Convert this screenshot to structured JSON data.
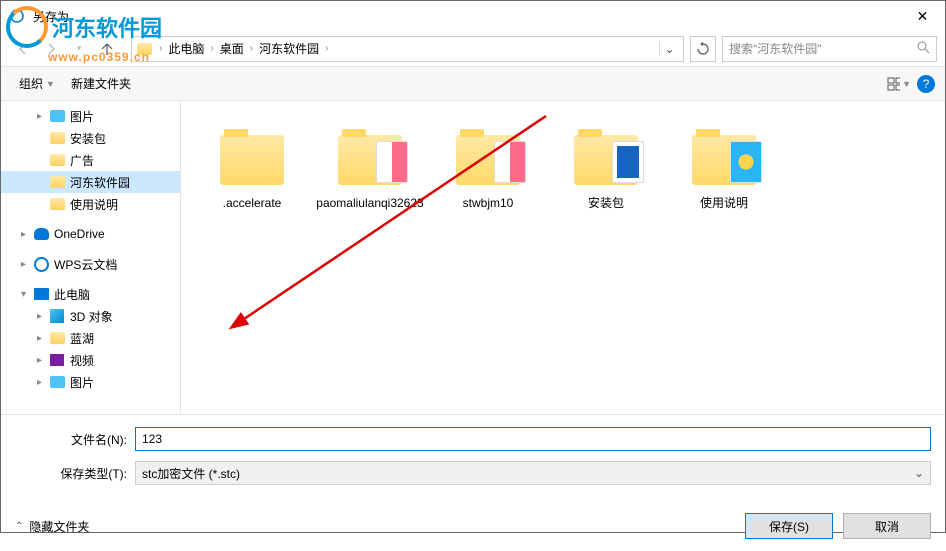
{
  "window": {
    "title": "另存为",
    "close": "✕"
  },
  "watermark": {
    "text": "河东软件园",
    "url": "www.pc0359.cn"
  },
  "breadcrumb": {
    "items": [
      "此电脑",
      "桌面",
      "河东软件园"
    ]
  },
  "search": {
    "placeholder": "搜索\"河东软件园\""
  },
  "toolbar": {
    "organize": "组织",
    "newfolder": "新建文件夹"
  },
  "sidebar": {
    "items": [
      {
        "label": "图片",
        "icon": "pic",
        "lvl": 2,
        "chev": "▸"
      },
      {
        "label": "安装包",
        "icon": "folder",
        "lvl": 2
      },
      {
        "label": "广告",
        "icon": "folder",
        "lvl": 2
      },
      {
        "label": "河东软件园",
        "icon": "folder",
        "lvl": 2,
        "sel": true
      },
      {
        "label": "使用说明",
        "icon": "folder",
        "lvl": 2
      },
      {
        "label": "",
        "spacer": true
      },
      {
        "label": "OneDrive",
        "icon": "onedrive",
        "lvl": 1,
        "chev": "▸"
      },
      {
        "label": "",
        "spacer": true
      },
      {
        "label": "WPS云文档",
        "icon": "wps",
        "lvl": 1,
        "chev": "▸"
      },
      {
        "label": "",
        "spacer": true
      },
      {
        "label": "此电脑",
        "icon": "pc",
        "lvl": 1,
        "chev": "▾"
      },
      {
        "label": "3D 对象",
        "icon": "cube",
        "lvl": 2,
        "chev": "▸"
      },
      {
        "label": "蓝湖",
        "icon": "folder",
        "lvl": 2,
        "chev": "▸"
      },
      {
        "label": "视频",
        "icon": "vid",
        "lvl": 2,
        "chev": "▸"
      },
      {
        "label": "图片",
        "icon": "pic",
        "lvl": 2,
        "chev": "▸"
      }
    ]
  },
  "files": [
    {
      "name": ".accelerate",
      "type": "folder"
    },
    {
      "name": "paomaliulanqi32623",
      "type": "folder-pink"
    },
    {
      "name": "stwbjm10",
      "type": "folder-pink"
    },
    {
      "name": "安装包",
      "type": "folder-blue"
    },
    {
      "name": "使用说明",
      "type": "folder-ie"
    }
  ],
  "fields": {
    "filename_label": "文件名(N):",
    "filename_value": "123",
    "filetype_label": "保存类型(T):",
    "filetype_value": "stc加密文件 (*.stc)"
  },
  "footer": {
    "hide_folders": "隐藏文件夹",
    "save": "保存(S)",
    "cancel": "取消"
  }
}
